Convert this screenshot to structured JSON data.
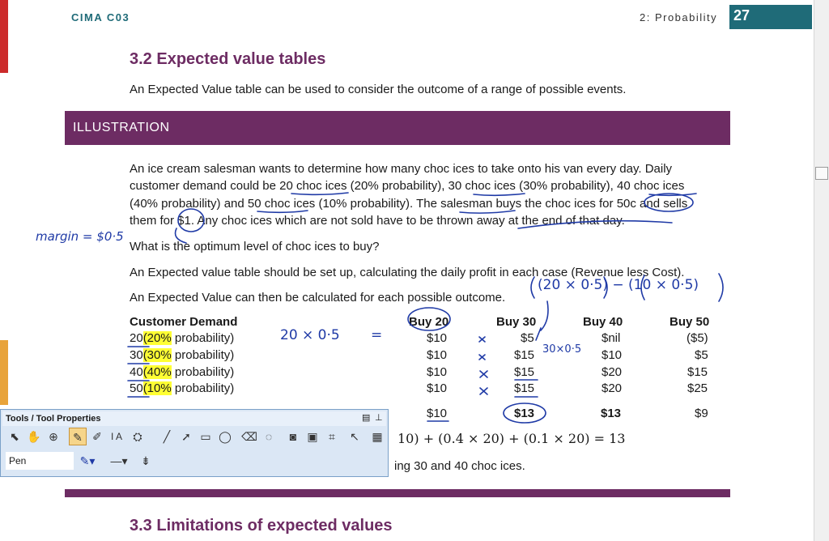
{
  "header": {
    "left": "CIMA C03",
    "right": "2: Probability",
    "page": "27"
  },
  "section32": {
    "title": "3.2 Expected value tables",
    "intro": "An Expected Value table can be used to consider the outcome of a range of possible events."
  },
  "illustration": {
    "label": "ILLUSTRATION",
    "para1": [
      "An ice cream salesman wants to determine how many choc ices to take onto his van every day. Daily",
      "customer demand could be 20 choc ices (20% probability), 30 choc ices (30% probability), 40 choc ices",
      "(40% probability) and 50 choc ices (10% probability). The salesman buys the choc ices for 50c and sells",
      "them for $1. Any choc ices which are not sold have to be thrown away at the end of that day."
    ],
    "question": "What is the optimum level of choc ices to buy?",
    "para2": "An Expected value table should be set up, calculating the daily profit in each case (Revenue less Cost).",
    "para3": "An Expected Value can then be calculated for each possible outcome."
  },
  "table": {
    "headers": [
      "Customer Demand",
      "Buy 20",
      "Buy 30",
      "Buy 40",
      "Buy 50"
    ],
    "rows": [
      {
        "demand": "20",
        "pct": "(20%",
        "rest": " probability)",
        "values": [
          "$10",
          "$5",
          "$nil",
          "($5)"
        ]
      },
      {
        "demand": "30",
        "pct": "(30%",
        "rest": " probability)",
        "values": [
          "$10",
          "$15",
          "$10",
          "$5"
        ]
      },
      {
        "demand": "40",
        "pct": "(40%",
        "rest": " probability)",
        "values": [
          "$10",
          "$15",
          "$20",
          "$15"
        ]
      },
      {
        "demand": "50",
        "pct": "(10%",
        "rest": " probability)",
        "values": [
          "$10",
          "$15",
          "$20",
          "$25"
        ]
      }
    ],
    "ev": [
      "$10",
      "$13",
      "$13",
      "$9"
    ]
  },
  "partial_formula": "10) + (0.4 × 20) + (0.1 × 20) = 13",
  "partial_text": "ing 30 and 40 choc ices.",
  "section33": {
    "title": "3.3 Limitations of expected values"
  },
  "annotations": {
    "margin": "margin = $0·5",
    "calc1": "20 × 0·5",
    "calc1_eq": "=",
    "calc2": "(20 × 0·5) − (10 × 0·5)",
    "calc3": "30×0·5"
  },
  "toolbox": {
    "title": "Tools / Tool Properties",
    "pen_label": "Pen",
    "icons": [
      "select-arrow-icon",
      "hand-icon",
      "zoom-icon",
      "pen-icon",
      "highlighter-icon",
      "text-icon",
      "stamp-icon",
      "line-icon",
      "arrow-icon",
      "rectangle-icon",
      "ellipse-icon",
      "eraser-icon",
      "lasso-icon",
      "camera-icon",
      "insert-image-icon",
      "crop-icon",
      "pointer-icon",
      "screen-icon"
    ]
  },
  "colors": {
    "accent": "#6d2c63",
    "teal": "#1f6b78",
    "ink": "#1f3aa6",
    "highlight": "#ffff33"
  }
}
